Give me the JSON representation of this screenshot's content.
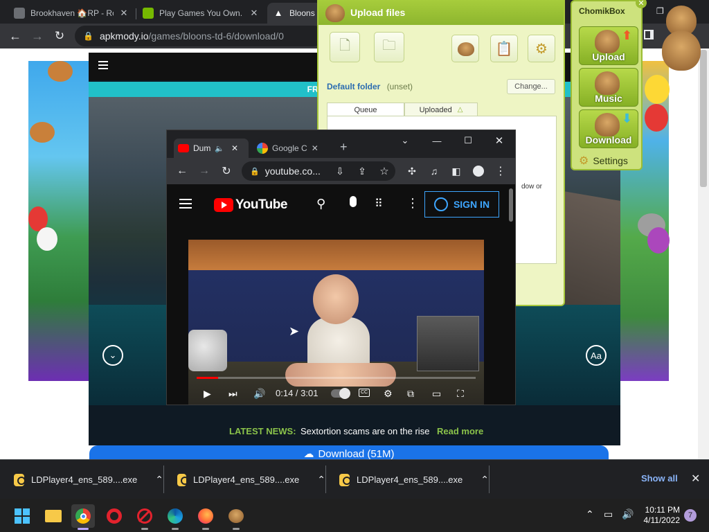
{
  "browser": {
    "tabs": [
      {
        "title": "Brookhaven 🏠RP - Ro",
        "icon": "roblox-icon",
        "active": false
      },
      {
        "title": "Play Games You Own. I",
        "icon": "geforce-now-icon",
        "active": false
      },
      {
        "title": "Bloons",
        "icon": "apkmody-icon",
        "active": true
      }
    ],
    "url_host": "apkmody.io",
    "url_path": "/games/bloons-td-6/download/0"
  },
  "site": {
    "promo_text": "FREE VERSION | GET O",
    "news_label": "LATEST NEWS:",
    "news_text": "Sextortion scams are on the rise",
    "news_link": "Read more",
    "download_label": "Download (51M)",
    "font_button_label": "Aa"
  },
  "upload_window": {
    "title": "Upload files",
    "default_folder_label": "Default folder",
    "default_folder_value": "(unset)",
    "change_label": "Change...",
    "tabs": [
      "Queue",
      "Uploaded"
    ],
    "queue_text": "dow or"
  },
  "chomikbox": {
    "title": "ChomikBox",
    "buttons": [
      "Upload",
      "Music",
      "Download"
    ],
    "settings_label": "Settings"
  },
  "yt_window": {
    "tabs": [
      {
        "title": "Dum",
        "icon": "youtube-icon",
        "active": true
      },
      {
        "title": "Google C",
        "icon": "google-icon",
        "active": false
      }
    ],
    "url": "youtube.co...",
    "logo_text": "YouTube",
    "signin_label": "SIGN IN",
    "video": {
      "timecode": "0:14 / 3:01",
      "progress": 0.077,
      "cc_label": "CC"
    }
  },
  "downloads": {
    "items": [
      "LDPlayer4_ens_589....exe",
      "LDPlayer4_ens_589....exe",
      "LDPlayer4_ens_589....exe"
    ],
    "show_all": "Show all"
  },
  "taskbar": {
    "apps": [
      "windows-start-icon",
      "file-explorer-icon",
      "chrome-icon",
      "opera-icon",
      "no-entry-app-icon",
      "edge-icon",
      "firefox-icon",
      "ldplayer-icon"
    ],
    "time": "10:11 PM",
    "date": "4/11/2022",
    "notification_count": "7"
  },
  "colors": {
    "youtube_red": "#ff0000",
    "chomik_green": "#a7cd3c",
    "chrome_dark": "#202124",
    "link_blue": "#8ab4f8"
  }
}
